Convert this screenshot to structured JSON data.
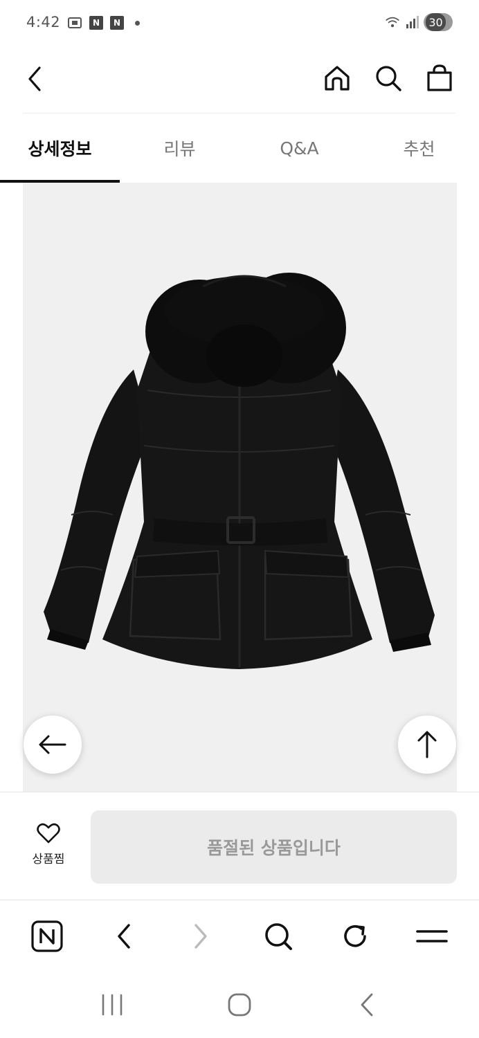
{
  "status_bar": {
    "time": "4:42",
    "battery": "30",
    "left_icons": [
      "screenshot-icon",
      "naver-n-icon",
      "naver-n-icon",
      "notification-dot-icon"
    ],
    "right_icons": [
      "wifi-icon",
      "signal-icon",
      "battery-icon"
    ]
  },
  "header": {
    "icons": [
      "back-arrow-icon",
      "home-icon",
      "search-icon",
      "shopping-bag-icon"
    ]
  },
  "tabs": [
    {
      "label": "상세정보",
      "active": true
    },
    {
      "label": "리뷰",
      "active": false
    },
    {
      "label": "Q&A",
      "active": false
    },
    {
      "label": "추천",
      "active": false
    }
  ],
  "product_image": {
    "subject": "black-puffer-jacket-with-fur-hood"
  },
  "floating_buttons": {
    "icons": [
      "arrow-left-icon",
      "arrow-up-icon"
    ]
  },
  "purchase_bar": {
    "wishlist_label": "상품찜",
    "soldout_label": "품절된 상품입니다"
  },
  "browser_bar": {
    "naver_label": "N",
    "icons": [
      "naver-home-icon",
      "browser-back-icon",
      "browser-forward-icon",
      "browser-search-icon",
      "refresh-icon",
      "menu-icon"
    ]
  },
  "system_nav": {
    "icons": [
      "recent-apps-icon",
      "home-circle-icon",
      "system-back-icon"
    ]
  },
  "colors": {
    "text_primary": "#111111",
    "text_muted": "#777777",
    "image_bg": "#f0f0f0",
    "soldout_bg": "#ebebeb",
    "soldout_text": "#999999"
  }
}
